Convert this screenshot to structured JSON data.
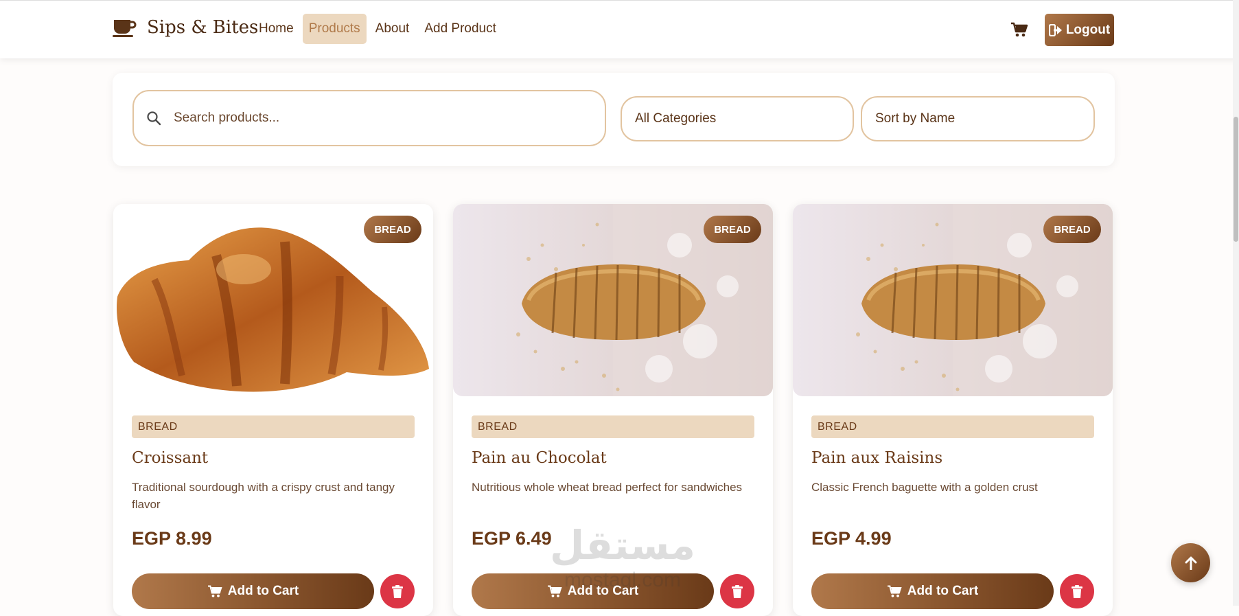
{
  "brand": {
    "name": "Sips & Bites",
    "icon": "coffee-cup-icon"
  },
  "nav": {
    "items": [
      {
        "label": "Home",
        "active": false
      },
      {
        "label": "Products",
        "active": true
      },
      {
        "label": "About",
        "active": false
      },
      {
        "label": "Add Product",
        "active": false
      }
    ],
    "cart_icon": "cart-icon",
    "logout_label": "Logout"
  },
  "filters": {
    "search_placeholder": "Search products...",
    "category_value": "All Categories",
    "sort_value": "Sort by Name"
  },
  "products": [
    {
      "badge": "BREAD",
      "category": "BREAD",
      "name": "Croissant",
      "description": "Traditional sourdough with a crispy crust and tangy flavor",
      "price": "EGP 8.99",
      "add_label": "Add to Cart",
      "image": "croissant"
    },
    {
      "badge": "BREAD",
      "category": "BREAD",
      "name": "Pain au Chocolat",
      "description": "Nutritious whole wheat bread perfect for sandwiches",
      "price": "EGP 6.49",
      "add_label": "Add to Cart",
      "image": "sliced-loaf"
    },
    {
      "badge": "BREAD",
      "category": "BREAD",
      "name": "Pain aux Raisins",
      "description": "Classic French baguette with a golden crust",
      "price": "EGP 4.99",
      "add_label": "Add to Cart",
      "image": "sliced-loaf"
    }
  ],
  "watermark": {
    "arabic": "مستقل",
    "latin": "mostaql.com"
  },
  "colors": {
    "accent": "#6a3a18",
    "accent_light": "#b0784a",
    "chip": "#ecd8bf",
    "delete": "#dc3545",
    "border": "#e2c4a0"
  }
}
